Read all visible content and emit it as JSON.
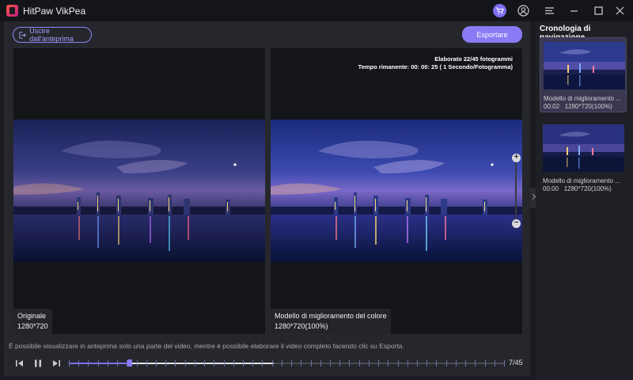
{
  "app": {
    "title": "HitPaw VikPea"
  },
  "titlebar_icons": [
    "cart-icon",
    "user-icon",
    "menu-icon",
    "minimize-icon",
    "maximize-icon",
    "close-icon"
  ],
  "toolbar": {
    "exit_label": "Uscire dall'anteprima",
    "export_label": "Esportare"
  },
  "panes": {
    "original": {
      "name": "Originale",
      "resolution": "1280*720"
    },
    "enhanced": {
      "name": "Modello di miglioramento del colore",
      "resolution": "1280*720(100%)"
    }
  },
  "progress": {
    "processed": "Elaborato 22/45 fotogrammi",
    "remaining": "Tempo rimanente: 00: 00: 25 ( 1 Secondo/Fotogramma)"
  },
  "footer": {
    "note": "È possibile visualizzare in anteprima solo una parte del video, mentre è possibile elaborare il video completo facendo clic su Esporta.",
    "frame_counter": "7/45",
    "timeline_position": 0.14,
    "timeline_processed": 0.47
  },
  "sidebar": {
    "title": "Cronologia di navigazione",
    "items": [
      {
        "name": "Modello di miglioramento ...",
        "duration": "00:02",
        "resolution": "1280*720(100%)",
        "selected": true
      },
      {
        "name": "Modello di miglioramento ...",
        "duration": "00:00",
        "resolution": "1280*720(100%)",
        "selected": false
      }
    ]
  },
  "colors": {
    "accent": "#8a7bf5",
    "background": "#1b1c21",
    "panel": "#26272d"
  }
}
